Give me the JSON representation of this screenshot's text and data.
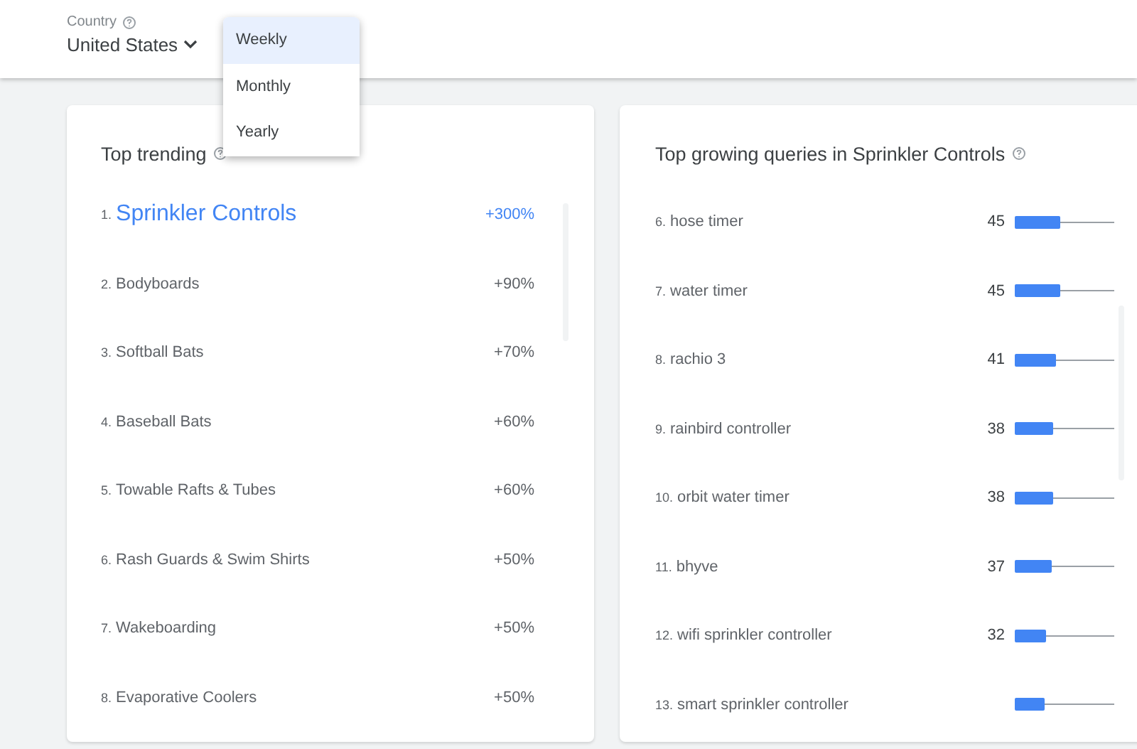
{
  "header": {
    "country_label": "Country",
    "country_value": "United States"
  },
  "period_menu": [
    {
      "label": "Weekly",
      "selected": true
    },
    {
      "label": "Monthly",
      "selected": false
    },
    {
      "label": "Yearly",
      "selected": false
    }
  ],
  "trending_categories": {
    "title": "Top trending",
    "items": [
      {
        "rank": "1.",
        "name": "Sprinkler Controls",
        "change": "+300%",
        "selected": true
      },
      {
        "rank": "2.",
        "name": "Bodyboards",
        "change": "+90%",
        "selected": false
      },
      {
        "rank": "3.",
        "name": "Softball Bats",
        "change": "+70%",
        "selected": false
      },
      {
        "rank": "4.",
        "name": "Baseball Bats",
        "change": "+60%",
        "selected": false
      },
      {
        "rank": "5.",
        "name": "Towable Rafts & Tubes",
        "change": "+60%",
        "selected": false
      },
      {
        "rank": "6.",
        "name": "Rash Guards & Swim Shirts",
        "change": "+50%",
        "selected": false
      },
      {
        "rank": "7.",
        "name": "Wakeboarding",
        "change": "+50%",
        "selected": false
      },
      {
        "rank": "8.",
        "name": "Evaporative Coolers",
        "change": "+50%",
        "selected": false
      }
    ]
  },
  "growing_queries": {
    "title": "Top growing queries in Sprinkler Controls",
    "items": [
      {
        "rank": "6.",
        "query": "hose timer",
        "value": "45",
        "level": 0.45
      },
      {
        "rank": "7.",
        "query": "water timer",
        "value": "45",
        "level": 0.45
      },
      {
        "rank": "8.",
        "query": "rachio 3",
        "value": "41",
        "level": 0.41
      },
      {
        "rank": "9.",
        "query": "rainbird controller",
        "value": "38",
        "level": 0.38
      },
      {
        "rank": "10.",
        "query": "orbit water timer",
        "value": "38",
        "level": 0.38
      },
      {
        "rank": "11.",
        "query": "bhyve",
        "value": "37",
        "level": 0.37
      },
      {
        "rank": "12.",
        "query": "wifi sprinkler controller",
        "value": "32",
        "level": 0.32
      },
      {
        "rank": "13.",
        "query": "smart sprinkler controller",
        "level": 0.3
      }
    ]
  }
}
